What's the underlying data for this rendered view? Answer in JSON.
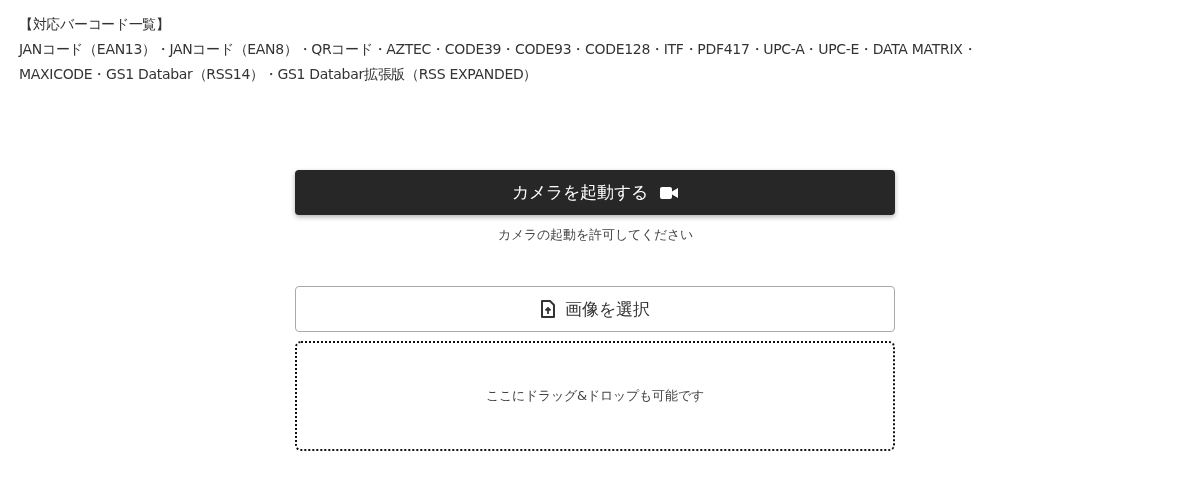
{
  "heading": "【対応バーコード一覧】",
  "barcode_lines": [
    "JANコード（EAN13）・JANコード（EAN8）・QRコード・AZTEC・CODE39・CODE93・CODE128・ITF・PDF417・UPC-A・UPC-E・DATA MATRIX・",
    "MAXICODE・GS1 Databar（RSS14）・GS1 Databar拡張版（RSS EXPANDED）"
  ],
  "camera_button": {
    "label": "カメラを起動する"
  },
  "camera_hint": "カメラの起動を許可してください",
  "file_button": {
    "label": "画像を選択"
  },
  "drop_zone": {
    "text": "ここにドラッグ&ドロップも可能です"
  }
}
